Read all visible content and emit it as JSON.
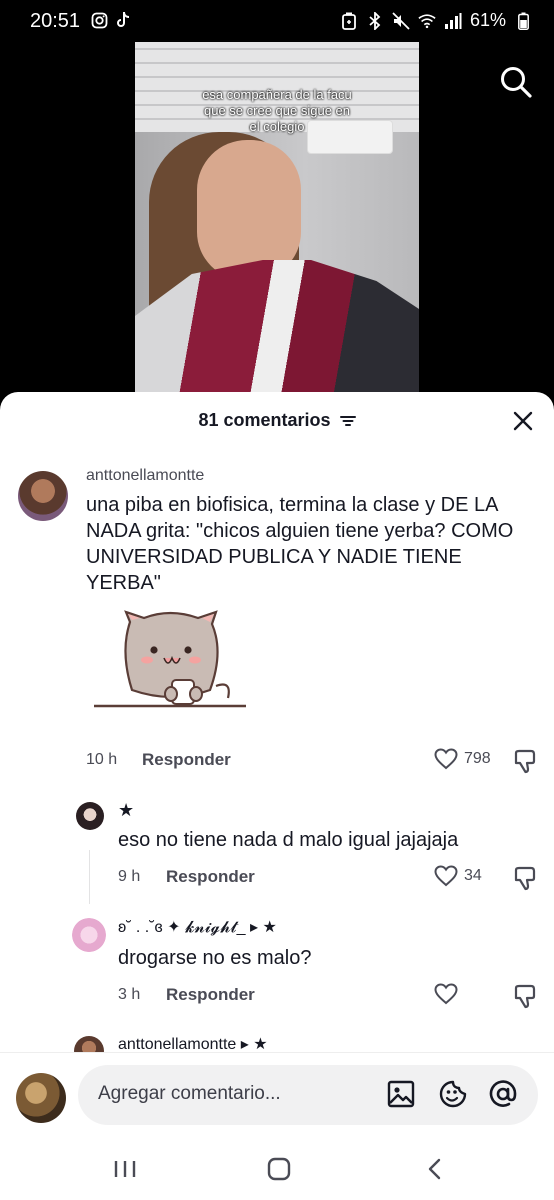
{
  "status_bar": {
    "time": "20:51",
    "battery": "61%",
    "left_icons": [
      "instagram-icon",
      "tiktok-icon"
    ],
    "right_icons": [
      "battery-saver-icon",
      "bluetooth-icon",
      "mute-icon",
      "wifi-icon",
      "signal-icon",
      "battery-icon"
    ]
  },
  "video": {
    "caption_lines": [
      "esa compañera de la facu",
      "que se cree que sigue en",
      "el colegio"
    ]
  },
  "comments_sheet": {
    "title": "81 comentarios",
    "comments": [
      {
        "username": "anttonellamontte",
        "text": "una piba en biofisica, termina la clase y DE LA NADA grita: \"chicos alguien tiene yerba? COMO UNIVERSIDAD PUBLICA Y NADIE TIENE YERBA\"",
        "time": "10 h",
        "reply_label": "Responder",
        "likes": "798",
        "sticker": "cat-sticker"
      },
      {
        "username": "★",
        "text": "eso no tiene nada d malo igual jajajaja",
        "time": "9 h",
        "reply_label": "Responder",
        "likes": "34"
      },
      {
        "username": "ʚ˘ . .˘ɞ ✦ 𝓴𝓷𝓲𝓰𝓱𝓽_ ▸ ★",
        "text": "drogarse no es malo?",
        "time": "3 h",
        "reply_label": "Responder",
        "likes": ""
      },
      {
        "username": "anttonellamontte ▸ ★"
      }
    ]
  },
  "input": {
    "placeholder": "Agregar comentario..."
  },
  "colors": {
    "text_primary": "#161823",
    "text_secondary": "#4a4b55",
    "input_bg": "#f1f1f2"
  }
}
